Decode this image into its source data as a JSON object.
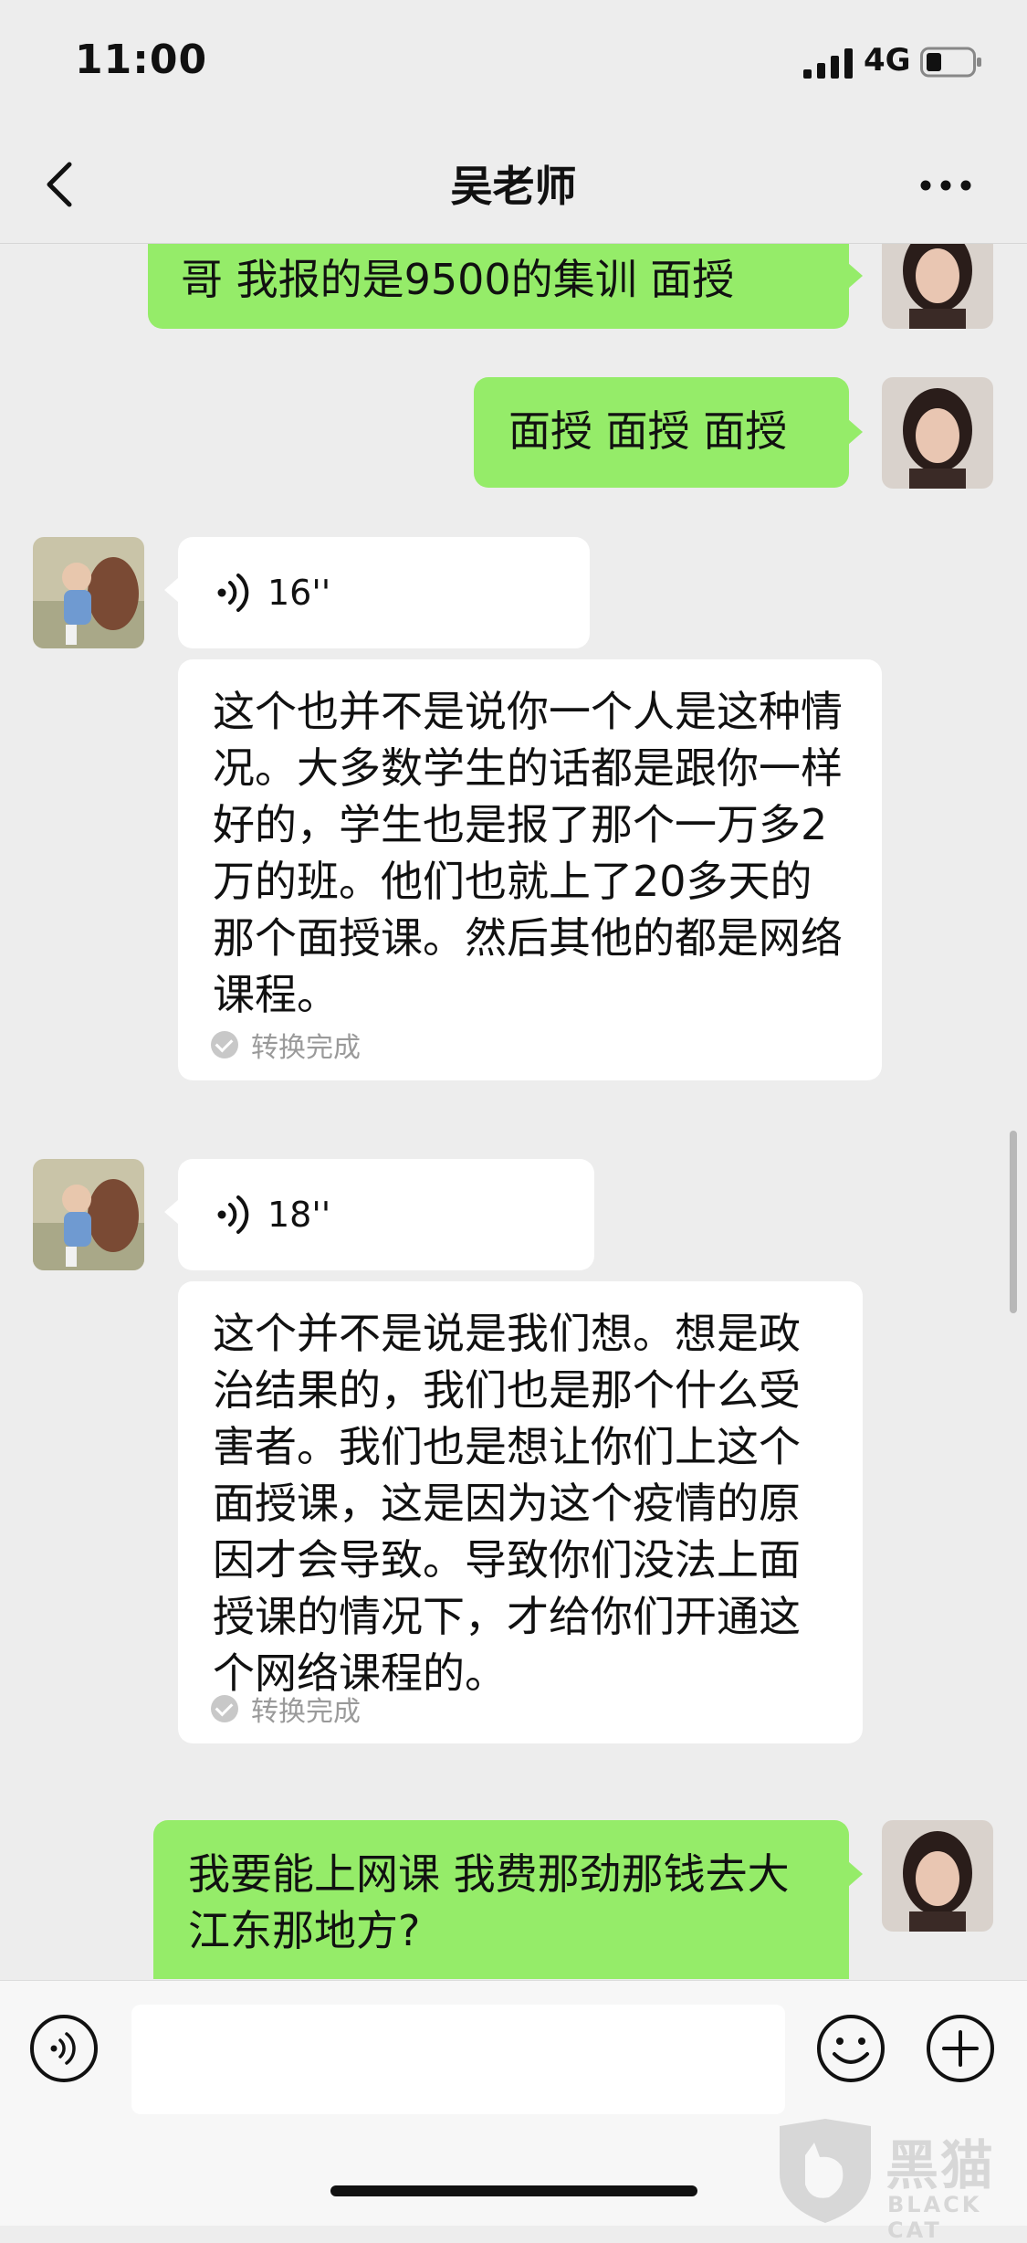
{
  "status_bar": {
    "time": "11:00",
    "network": "4G"
  },
  "nav": {
    "title": "吴老师"
  },
  "messages": [
    {
      "text": "哥 我报的是9500的集训 面授"
    },
    {
      "text": "面授 面授 面授"
    },
    {
      "voice_duration": "16''",
      "transcript": "这个也并不是说你一个人是这种情况。大多数学生的话都是跟你一样好的，学生也是报了那个一万多2万的班。他们也就上了20多天的那个面授课。然后其他的都是网络课程。",
      "status": "转换完成"
    },
    {
      "voice_duration": "18''",
      "transcript": "这个并不是说是我们想。想是政治结果的，我们也是那个什么受害者。我们也是想让你们上这个面授课，这是因为这个疫情的原因才会导致。导致你们没法上面授课的情况下，才给你们开通这个网络课程的。",
      "status": "转换完成"
    },
    {
      "text": "我要能上网课 我费那劲那钱去大江东那地方?"
    }
  ],
  "watermark": {
    "title": "黑猫",
    "subtitle": "BLACK CAT"
  },
  "colors": {
    "sent_bubble": "#95ec69",
    "received_bubble": "#ffffff",
    "background": "#ededed"
  }
}
